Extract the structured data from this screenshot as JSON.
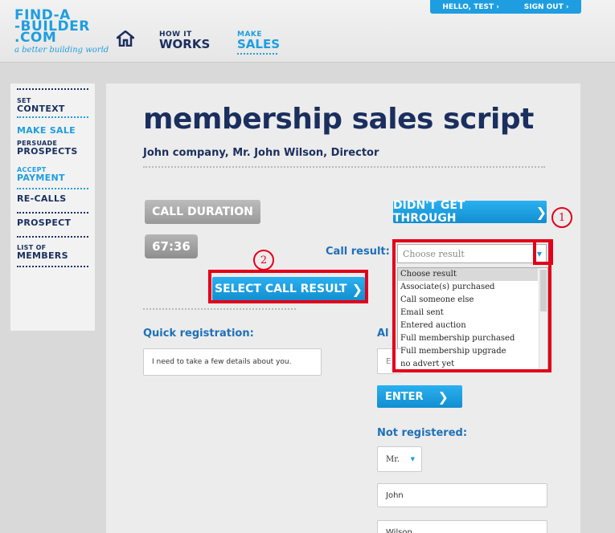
{
  "header": {
    "logo_lines": [
      "FIND-A",
      "-BUILDER",
      ".COM"
    ],
    "logo_tagline": "a better building world",
    "nav": {
      "how": {
        "small": "HOW IT",
        "big": "WORKS"
      },
      "sales": {
        "small": "MAKE",
        "big": "SALES"
      }
    },
    "account": {
      "greeting": "HELLO, TEST",
      "signout": "SIGN OUT"
    }
  },
  "sidebar": {
    "items": [
      {
        "small": "SET",
        "big": "CONTEXT"
      },
      {
        "small": "",
        "big": "MAKE SALE"
      },
      {
        "small": "PERSUADE",
        "big": "PROSPECTS"
      },
      {
        "small": "ACCEPT",
        "big": "PAYMENT"
      },
      {
        "small": "",
        "big": "RE-CALLS"
      },
      {
        "small": "",
        "big": "PROSPECT"
      },
      {
        "small": "LIST OF",
        "big": "MEMBERS"
      }
    ]
  },
  "main": {
    "title": "membership sales script",
    "subtitle": "John company, Mr. John Wilson, Director",
    "call_duration_label": "CALL DURATION",
    "timer": "67:36",
    "didnt_get_through": "DIDN'T GET THROUGH",
    "call_result_label": "Call result:",
    "call_result_placeholder": "Choose result",
    "call_result_options": [
      "Choose result",
      "Associate(s) purchased",
      "Call someone else",
      "Email sent",
      "Entered auction",
      "Full membership purchased",
      "Full membership upgrade",
      "no advert yet"
    ],
    "select_call_result": "SELECT CALL RESULT",
    "quick_registration_label": "Quick registration:",
    "quick_registration_text": "I need to take a few details about you.",
    "already_label": "Al",
    "email_placeholder": "E",
    "enter_label": "ENTER",
    "not_registered_label": "Not registered:",
    "title_value": "Mr.",
    "first_name_value": "John",
    "last_name_value": "Wilson"
  },
  "annotations": {
    "one": "1",
    "two": "2"
  },
  "colors": {
    "navy": "#1a2f5e",
    "blue": "#1e9ee0",
    "red": "#e2001a"
  }
}
